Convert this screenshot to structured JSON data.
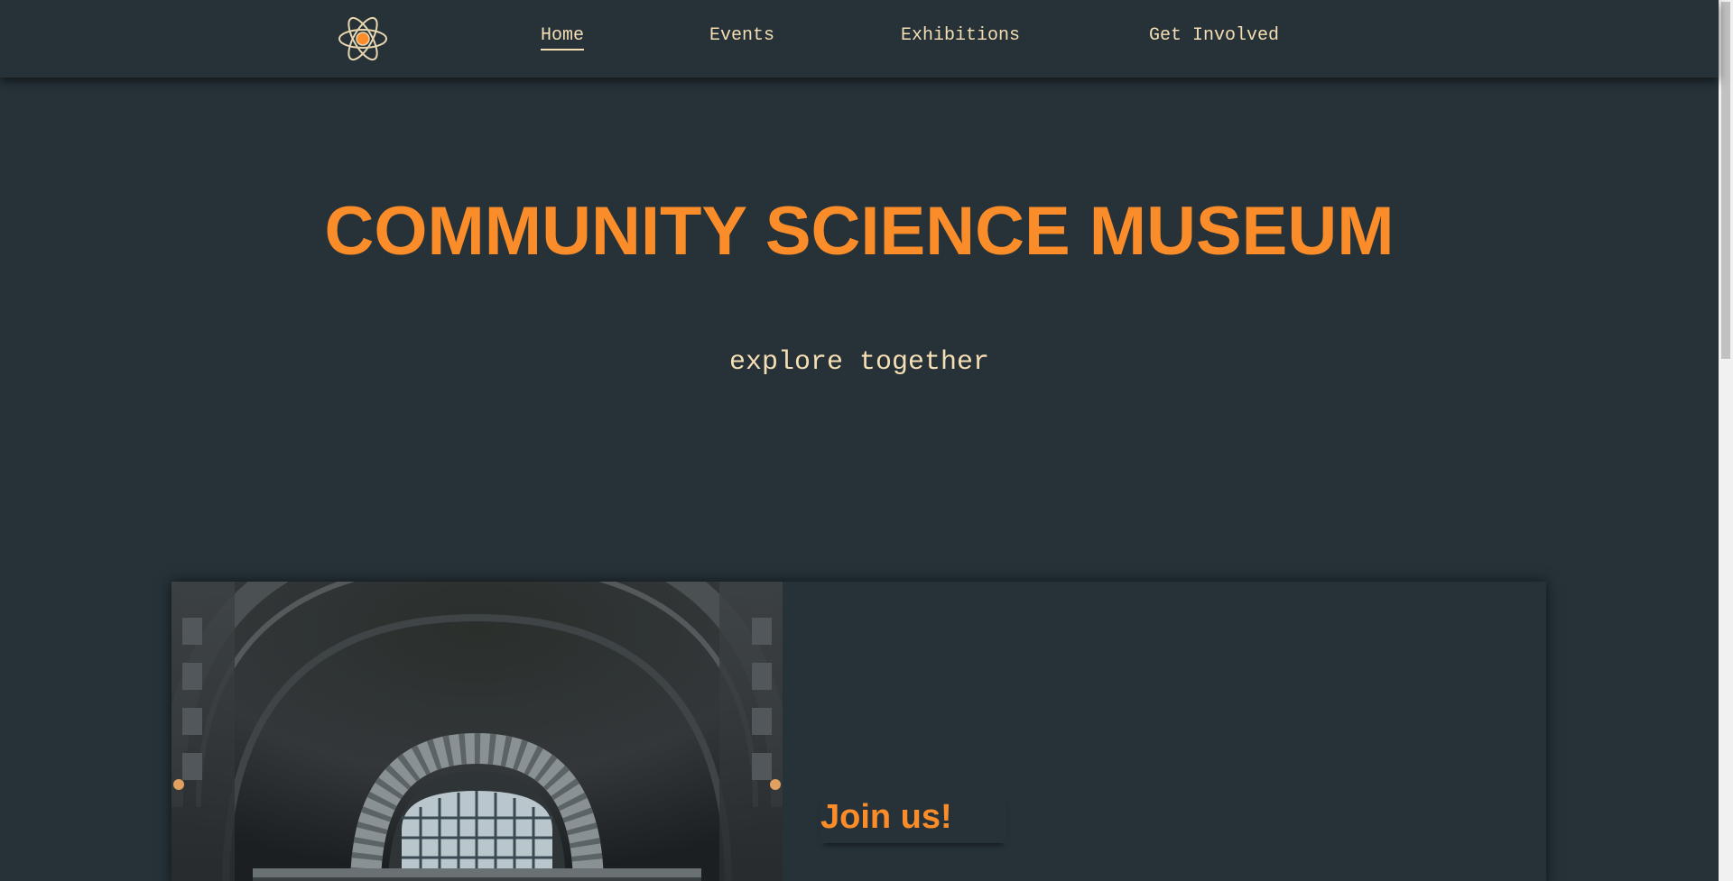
{
  "nav": {
    "logo_icon": "atom-icon",
    "links": [
      {
        "label": "Home",
        "active": true
      },
      {
        "label": "Events",
        "active": false
      },
      {
        "label": "Exhibitions",
        "active": false
      },
      {
        "label": "Get Involved",
        "active": false
      }
    ]
  },
  "hero": {
    "title": "COMMUNITY SCIENCE MUSEUM",
    "subtitle": "explore together"
  },
  "feature_card": {
    "heading": "Join us!",
    "image_icon": "museum-dome-photo"
  },
  "colors": {
    "background": "#263238",
    "accent": "#fb8c2a",
    "text": "#f5deb3"
  }
}
